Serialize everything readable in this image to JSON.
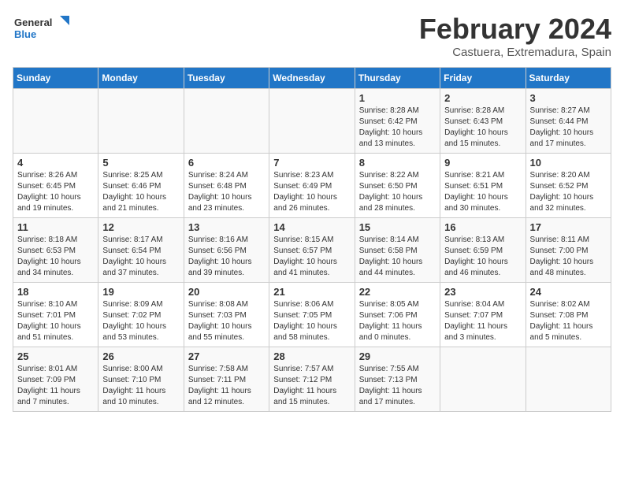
{
  "logo": {
    "line1": "General",
    "line2": "Blue"
  },
  "title": "February 2024",
  "location": "Castuera, Extremadura, Spain",
  "days_of_week": [
    "Sunday",
    "Monday",
    "Tuesday",
    "Wednesday",
    "Thursday",
    "Friday",
    "Saturday"
  ],
  "weeks": [
    [
      {
        "num": "",
        "info": ""
      },
      {
        "num": "",
        "info": ""
      },
      {
        "num": "",
        "info": ""
      },
      {
        "num": "",
        "info": ""
      },
      {
        "num": "1",
        "info": "Sunrise: 8:28 AM\nSunset: 6:42 PM\nDaylight: 10 hours\nand 13 minutes."
      },
      {
        "num": "2",
        "info": "Sunrise: 8:28 AM\nSunset: 6:43 PM\nDaylight: 10 hours\nand 15 minutes."
      },
      {
        "num": "3",
        "info": "Sunrise: 8:27 AM\nSunset: 6:44 PM\nDaylight: 10 hours\nand 17 minutes."
      }
    ],
    [
      {
        "num": "4",
        "info": "Sunrise: 8:26 AM\nSunset: 6:45 PM\nDaylight: 10 hours\nand 19 minutes."
      },
      {
        "num": "5",
        "info": "Sunrise: 8:25 AM\nSunset: 6:46 PM\nDaylight: 10 hours\nand 21 minutes."
      },
      {
        "num": "6",
        "info": "Sunrise: 8:24 AM\nSunset: 6:48 PM\nDaylight: 10 hours\nand 23 minutes."
      },
      {
        "num": "7",
        "info": "Sunrise: 8:23 AM\nSunset: 6:49 PM\nDaylight: 10 hours\nand 26 minutes."
      },
      {
        "num": "8",
        "info": "Sunrise: 8:22 AM\nSunset: 6:50 PM\nDaylight: 10 hours\nand 28 minutes."
      },
      {
        "num": "9",
        "info": "Sunrise: 8:21 AM\nSunset: 6:51 PM\nDaylight: 10 hours\nand 30 minutes."
      },
      {
        "num": "10",
        "info": "Sunrise: 8:20 AM\nSunset: 6:52 PM\nDaylight: 10 hours\nand 32 minutes."
      }
    ],
    [
      {
        "num": "11",
        "info": "Sunrise: 8:18 AM\nSunset: 6:53 PM\nDaylight: 10 hours\nand 34 minutes."
      },
      {
        "num": "12",
        "info": "Sunrise: 8:17 AM\nSunset: 6:54 PM\nDaylight: 10 hours\nand 37 minutes."
      },
      {
        "num": "13",
        "info": "Sunrise: 8:16 AM\nSunset: 6:56 PM\nDaylight: 10 hours\nand 39 minutes."
      },
      {
        "num": "14",
        "info": "Sunrise: 8:15 AM\nSunset: 6:57 PM\nDaylight: 10 hours\nand 41 minutes."
      },
      {
        "num": "15",
        "info": "Sunrise: 8:14 AM\nSunset: 6:58 PM\nDaylight: 10 hours\nand 44 minutes."
      },
      {
        "num": "16",
        "info": "Sunrise: 8:13 AM\nSunset: 6:59 PM\nDaylight: 10 hours\nand 46 minutes."
      },
      {
        "num": "17",
        "info": "Sunrise: 8:11 AM\nSunset: 7:00 PM\nDaylight: 10 hours\nand 48 minutes."
      }
    ],
    [
      {
        "num": "18",
        "info": "Sunrise: 8:10 AM\nSunset: 7:01 PM\nDaylight: 10 hours\nand 51 minutes."
      },
      {
        "num": "19",
        "info": "Sunrise: 8:09 AM\nSunset: 7:02 PM\nDaylight: 10 hours\nand 53 minutes."
      },
      {
        "num": "20",
        "info": "Sunrise: 8:08 AM\nSunset: 7:03 PM\nDaylight: 10 hours\nand 55 minutes."
      },
      {
        "num": "21",
        "info": "Sunrise: 8:06 AM\nSunset: 7:05 PM\nDaylight: 10 hours\nand 58 minutes."
      },
      {
        "num": "22",
        "info": "Sunrise: 8:05 AM\nSunset: 7:06 PM\nDaylight: 11 hours\nand 0 minutes."
      },
      {
        "num": "23",
        "info": "Sunrise: 8:04 AM\nSunset: 7:07 PM\nDaylight: 11 hours\nand 3 minutes."
      },
      {
        "num": "24",
        "info": "Sunrise: 8:02 AM\nSunset: 7:08 PM\nDaylight: 11 hours\nand 5 minutes."
      }
    ],
    [
      {
        "num": "25",
        "info": "Sunrise: 8:01 AM\nSunset: 7:09 PM\nDaylight: 11 hours\nand 7 minutes."
      },
      {
        "num": "26",
        "info": "Sunrise: 8:00 AM\nSunset: 7:10 PM\nDaylight: 11 hours\nand 10 minutes."
      },
      {
        "num": "27",
        "info": "Sunrise: 7:58 AM\nSunset: 7:11 PM\nDaylight: 11 hours\nand 12 minutes."
      },
      {
        "num": "28",
        "info": "Sunrise: 7:57 AM\nSunset: 7:12 PM\nDaylight: 11 hours\nand 15 minutes."
      },
      {
        "num": "29",
        "info": "Sunrise: 7:55 AM\nSunset: 7:13 PM\nDaylight: 11 hours\nand 17 minutes."
      },
      {
        "num": "",
        "info": ""
      },
      {
        "num": "",
        "info": ""
      }
    ]
  ]
}
